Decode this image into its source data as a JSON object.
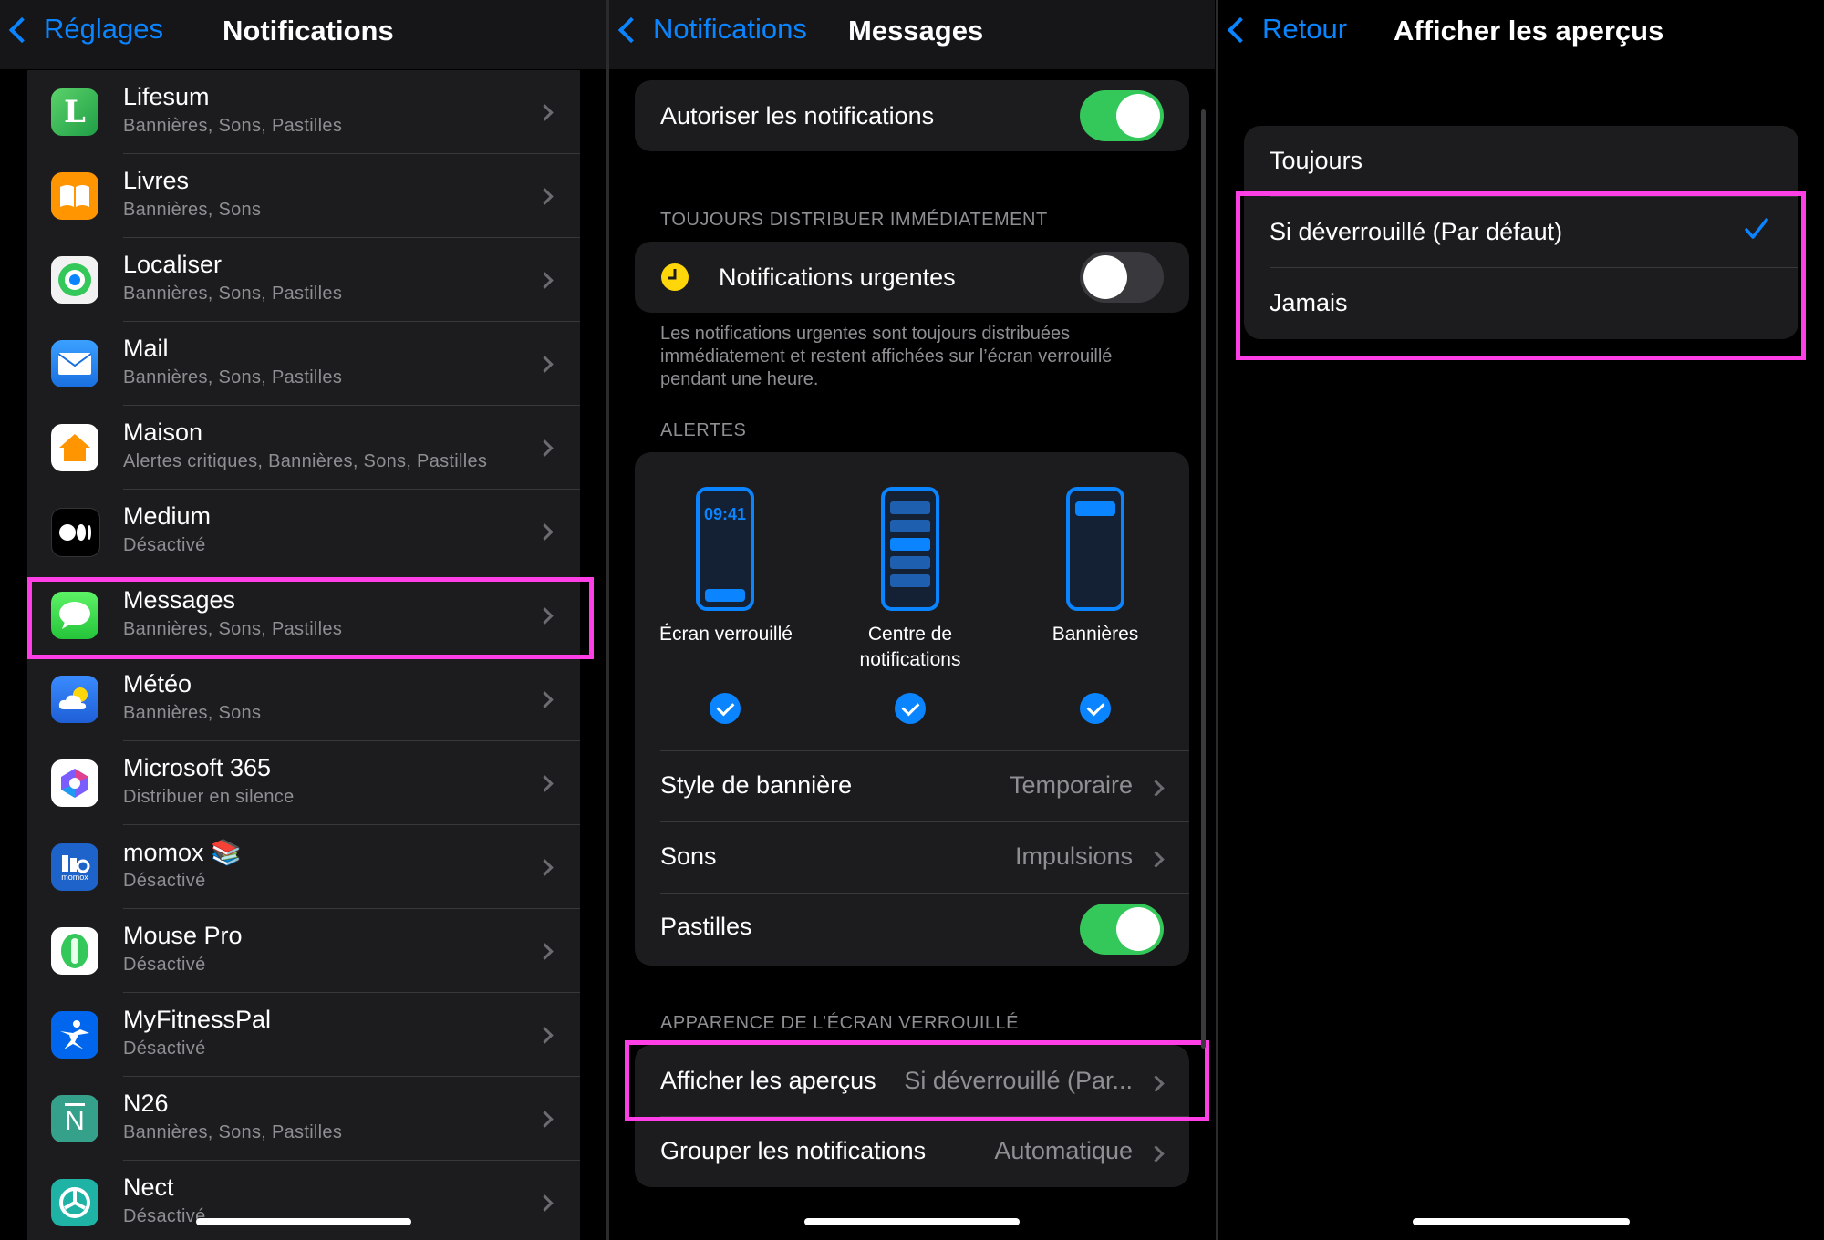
{
  "colors": {
    "accent": "#0a84ff",
    "toggle_on": "#34c759",
    "highlight": "#ff3fe6",
    "background": "#000000",
    "cell": "#1c1c1e"
  },
  "panel1": {
    "back_label": "Réglages",
    "title": "Notifications",
    "apps": [
      {
        "name": "Lifesum",
        "detail": "Bannières, Sons, Pastilles",
        "icon": "lifesum-icon"
      },
      {
        "name": "Livres",
        "detail": "Bannières, Sons",
        "icon": "books-icon"
      },
      {
        "name": "Localiser",
        "detail": "Bannières, Sons, Pastilles",
        "icon": "find-my-icon"
      },
      {
        "name": "Mail",
        "detail": "Bannières, Sons, Pastilles",
        "icon": "mail-icon"
      },
      {
        "name": "Maison",
        "detail": "Alertes critiques, Bannières, Sons, Pastilles",
        "icon": "home-app-icon"
      },
      {
        "name": "Medium",
        "detail": "Désactivé",
        "icon": "medium-icon"
      },
      {
        "name": "Messages",
        "detail": "Bannières, Sons, Pastilles",
        "icon": "messages-icon"
      },
      {
        "name": "Météo",
        "detail": "Bannières, Sons",
        "icon": "weather-icon"
      },
      {
        "name": "Microsoft 365",
        "detail": "Distribuer en silence",
        "icon": "microsoft-365-icon"
      },
      {
        "name": "momox 📚",
        "detail": "Désactivé",
        "icon": "momox-icon"
      },
      {
        "name": "Mouse Pro",
        "detail": "Désactivé",
        "icon": "mouse-pro-icon"
      },
      {
        "name": "MyFitnessPal",
        "detail": "Désactivé",
        "icon": "myfitnesspal-icon"
      },
      {
        "name": "N26",
        "detail": "Bannières, Sons, Pastilles",
        "icon": "n26-icon"
      },
      {
        "name": "Nect",
        "detail": "Désactivé",
        "icon": "nect-icon"
      }
    ],
    "icon_text": {
      "lifesum": "L",
      "momox": "momox",
      "n26": "N"
    }
  },
  "panel2": {
    "back_label": "Notifications",
    "title": "Messages",
    "allow_label": "Autoriser les notifications",
    "allow_on": true,
    "section_immediate": "TOUJOURS DISTRIBUER IMMÉDIATEMENT",
    "urgent_label": "Notifications urgentes",
    "urgent_on": false,
    "urgent_footnote": "Les notifications urgentes sont toujours distribuées immédiatement et restent affichées sur l’écran verrouillé pendant une heure.",
    "section_alerts": "ALERTES",
    "alerts": [
      {
        "label": "Écran verrouillé",
        "checked": true,
        "phone_time": "09:41"
      },
      {
        "label": "Centre de notifications",
        "checked": true
      },
      {
        "label": "Bannières",
        "checked": true
      }
    ],
    "banner_style_label": "Style de bannière",
    "banner_style_value": "Temporaire",
    "sounds_label": "Sons",
    "sounds_value": "Impulsions",
    "badges_label": "Pastilles",
    "badges_on": true,
    "section_lockscreen": "APPARENCE DE L’ÉCRAN VERROUILLÉ",
    "previews_label": "Afficher les aperçus",
    "previews_value": "Si déverrouillé (Par...",
    "group_label": "Grouper les notifications",
    "group_value": "Automatique"
  },
  "panel3": {
    "back_label": "Retour",
    "title": "Afficher les aperçus",
    "options": [
      {
        "label": "Toujours",
        "selected": false
      },
      {
        "label": "Si déverrouillé (Par défaut)",
        "selected": true
      },
      {
        "label": "Jamais",
        "selected": false
      }
    ]
  }
}
